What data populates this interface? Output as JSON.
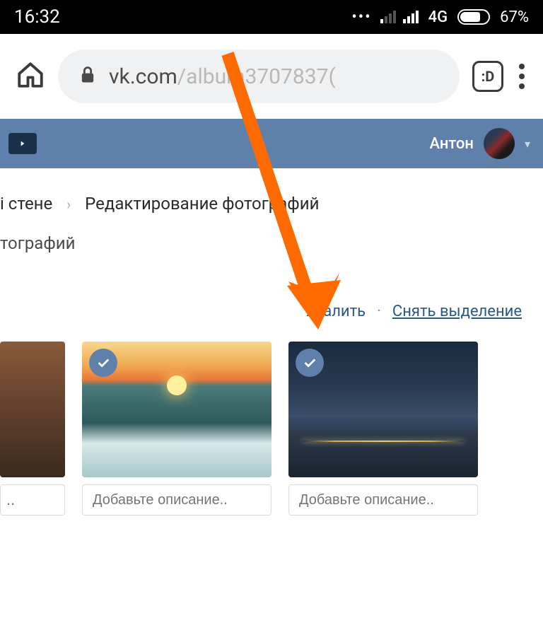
{
  "status": {
    "time": "16:32",
    "network": "4G",
    "battery_pct": "67%"
  },
  "browser": {
    "url_domain": "vk.com",
    "url_path": "/album3707837(",
    "tab_indicator": ":D"
  },
  "vk": {
    "user_name": "Антон"
  },
  "breadcrumb": {
    "prev_fragment": "і стене",
    "current": "Редактирование фотографий"
  },
  "sub_label_fragment": "тографий",
  "actions": {
    "delete": "Удалить",
    "deselect": "Снять выделение"
  },
  "photos": [
    {
      "caption_placeholder": "..",
      "selected": false
    },
    {
      "caption_placeholder": "Добавьте описание..",
      "selected": true
    },
    {
      "caption_placeholder": "Добавьте описание..",
      "selected": true
    }
  ],
  "arrow": {
    "color": "#ff6a00"
  }
}
